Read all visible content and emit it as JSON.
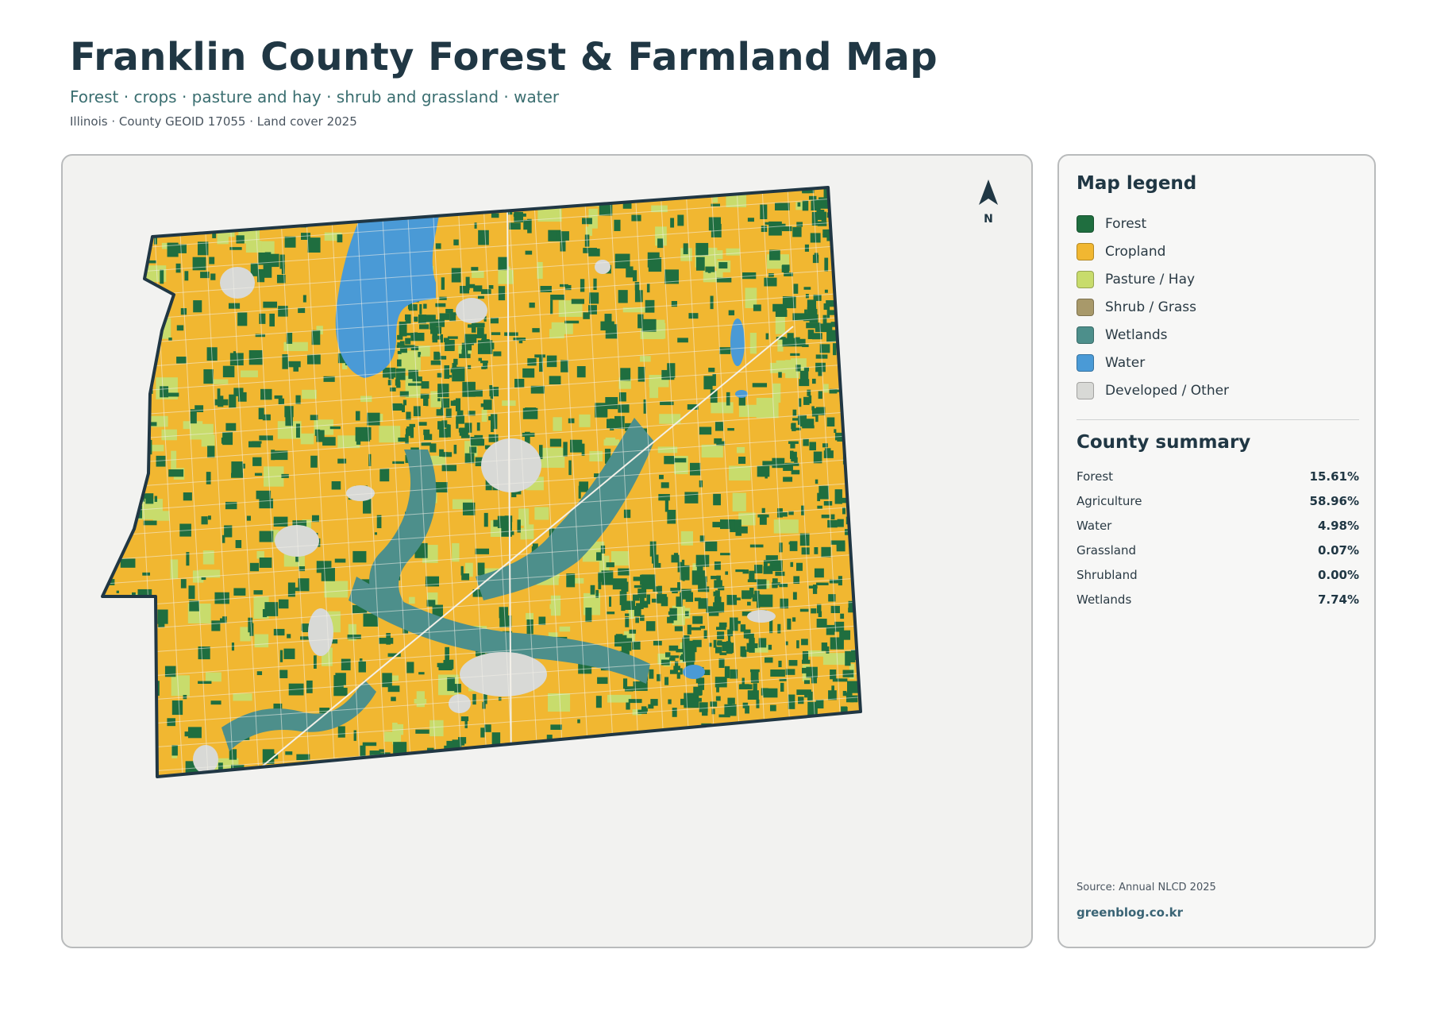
{
  "header": {
    "title": "Franklin County Forest & Farmland Map",
    "subtitle": "Forest · crops · pasture and hay · shrub and grassland · water",
    "meta": "Illinois · County GEOID 17055 · Land cover 2025"
  },
  "map": {
    "north_label": "N",
    "colors": {
      "forest": "#1f6e3f",
      "cropland": "#f1b731",
      "pasture": "#c8dc6c",
      "shrub": "#a8996a",
      "wetlands": "#4d8f8b",
      "water": "#4a9ad6",
      "developed": "#d8d9d6",
      "outline": "#203744",
      "roads": "#f3f0e8"
    }
  },
  "legend": {
    "title": "Map legend",
    "items": [
      {
        "label": "Forest",
        "color": "#1f6e3f"
      },
      {
        "label": "Cropland",
        "color": "#f1b731"
      },
      {
        "label": "Pasture / Hay",
        "color": "#c8dc6c"
      },
      {
        "label": "Shrub / Grass",
        "color": "#a8996a"
      },
      {
        "label": "Wetlands",
        "color": "#4d8f8b"
      },
      {
        "label": "Water",
        "color": "#4a9ad6"
      },
      {
        "label": "Developed / Other",
        "color": "#d8d9d6"
      }
    ]
  },
  "summary": {
    "title": "County summary",
    "rows": [
      {
        "name": "Forest",
        "value": "15.61%"
      },
      {
        "name": "Agriculture",
        "value": "58.96%"
      },
      {
        "name": "Water",
        "value": "4.98%"
      },
      {
        "name": "Grassland",
        "value": "0.07%"
      },
      {
        "name": "Shrubland",
        "value": "0.00%"
      },
      {
        "name": "Wetlands",
        "value": "7.74%"
      }
    ]
  },
  "footer": {
    "source": "Source: Annual NLCD 2025",
    "site": "greenblog.co.kr"
  }
}
